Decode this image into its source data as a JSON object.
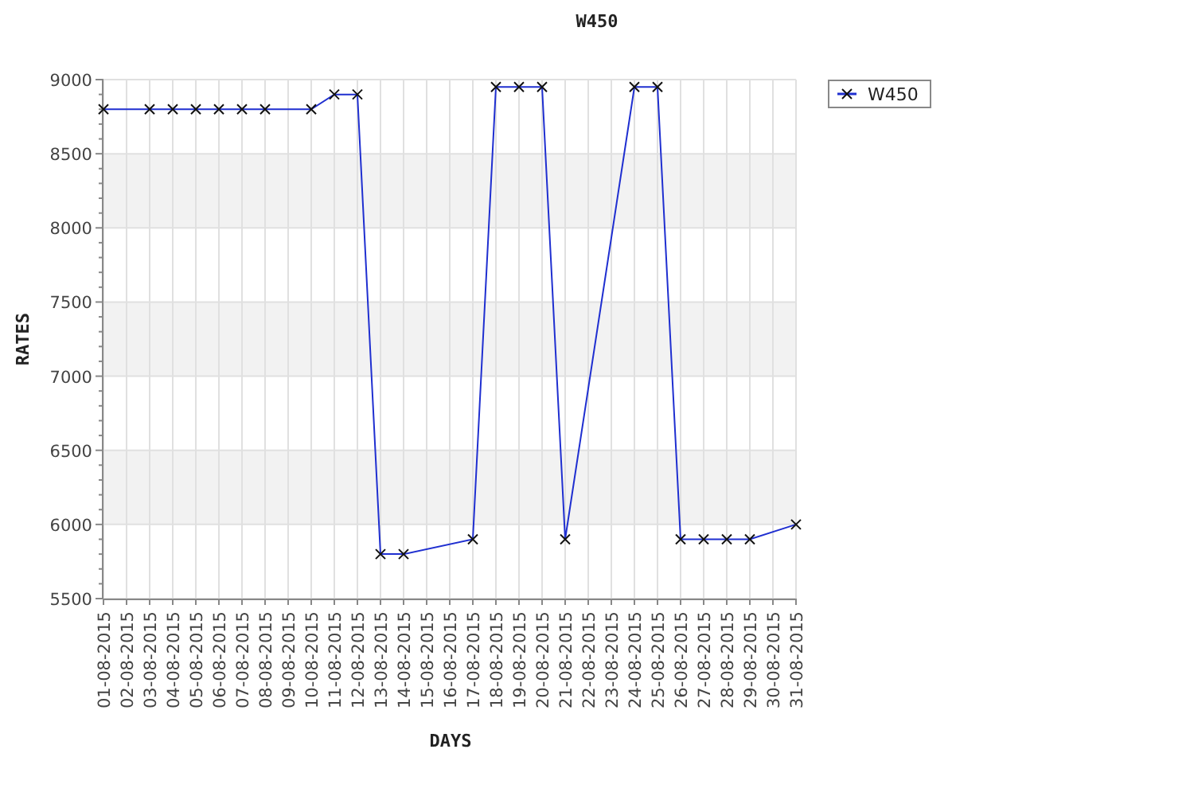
{
  "chart": {
    "chart_data": {
      "type": "line",
      "title": "W450",
      "xlabel": "DAYS",
      "ylabel": "RATES",
      "categories": [
        "01-08-2015",
        "02-08-2015",
        "03-08-2015",
        "04-08-2015",
        "05-08-2015",
        "06-08-2015",
        "07-08-2015",
        "08-08-2015",
        "09-08-2015",
        "10-08-2015",
        "11-08-2015",
        "12-08-2015",
        "13-08-2015",
        "14-08-2015",
        "15-08-2015",
        "16-08-2015",
        "17-08-2015",
        "18-08-2015",
        "19-08-2015",
        "20-08-2015",
        "21-08-2015",
        "22-08-2015",
        "23-08-2015",
        "24-08-2015",
        "25-08-2015",
        "26-08-2015",
        "27-08-2015",
        "28-08-2015",
        "29-08-2015",
        "30-08-2015",
        "31-08-2015"
      ],
      "grid": true,
      "series": [
        {
          "name": "W450",
          "color": "#1f2fd0",
          "marker": "x",
          "values": [
            8800,
            null,
            8800,
            8800,
            8800,
            8800,
            8800,
            8800,
            null,
            8800,
            8900,
            8900,
            5800,
            5800,
            null,
            null,
            5900,
            8950,
            8950,
            8950,
            5900,
            null,
            null,
            8950,
            8950,
            5900,
            5900,
            5900,
            5900,
            null,
            6000
          ]
        }
      ],
      "ylim": [
        5500,
        9000
      ],
      "yticks": [
        5500,
        6000,
        6500,
        7000,
        7500,
        8000,
        8500,
        9000
      ]
    }
  }
}
